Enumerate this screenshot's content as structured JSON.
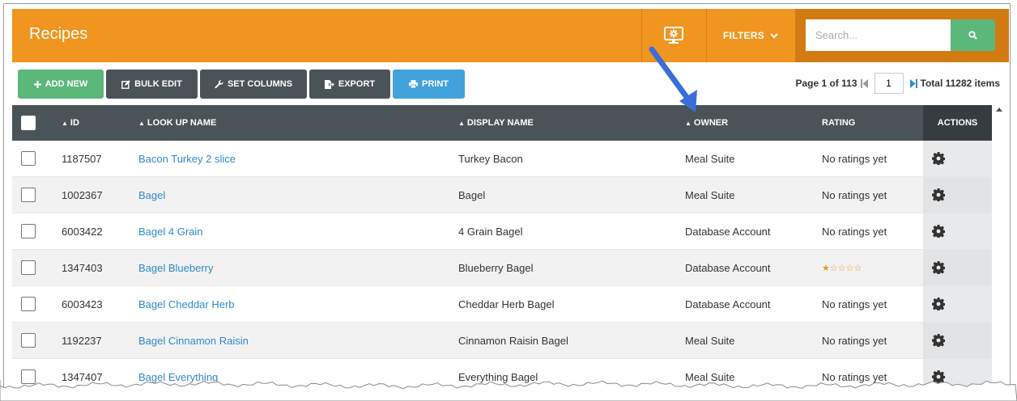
{
  "header": {
    "title": "Recipes",
    "filters_label": "FILTERS",
    "search_placeholder": "Search..."
  },
  "toolbar": {
    "add_new": "ADD NEW",
    "bulk_edit": "BULK EDIT",
    "set_columns": "SET COLUMNS",
    "export": "EXPORT",
    "print": "PRINT"
  },
  "pager": {
    "page_text": "Page 1 of 113",
    "current_page": "1",
    "total_text": "Total 11282 items"
  },
  "columns": {
    "id": "ID",
    "lookup_name": "LOOK UP NAME",
    "display_name": "DISPLAY NAME",
    "owner": "OWNER",
    "rating": "RATING",
    "actions": "ACTIONS"
  },
  "rows": [
    {
      "id": "1187507",
      "lookup": "Bacon Turkey 2 slice",
      "display": "Turkey Bacon",
      "owner": "Meal Suite",
      "rating": "No ratings yet",
      "stars": 0
    },
    {
      "id": "1002367",
      "lookup": "Bagel",
      "display": "Bagel",
      "owner": "Meal Suite",
      "rating": "No ratings yet",
      "stars": 0
    },
    {
      "id": "6003422",
      "lookup": "Bagel 4 Grain",
      "display": "4 Grain Bagel",
      "owner": "Database Account",
      "rating": "No ratings yet",
      "stars": 0
    },
    {
      "id": "1347403",
      "lookup": "Bagel Blueberry",
      "display": "Blueberry Bagel",
      "owner": "Database Account",
      "rating": "",
      "stars": 1
    },
    {
      "id": "6003423",
      "lookup": "Bagel Cheddar Herb",
      "display": "Cheddar Herb Bagel",
      "owner": "Database Account",
      "rating": "No ratings yet",
      "stars": 0
    },
    {
      "id": "1192237",
      "lookup": "Bagel Cinnamon Raisin",
      "display": "Cinnamon Raisin Bagel",
      "owner": "Meal Suite",
      "rating": "No ratings yet",
      "stars": 0
    },
    {
      "id": "1347407",
      "lookup": "Bagel Everything",
      "display": "Everything Bagel",
      "owner": "Meal Suite",
      "rating": "No ratings yet",
      "stars": 0
    }
  ],
  "colors": {
    "header_orange": "#f0951f",
    "search_bg": "#d27b12",
    "green": "#5cb87a",
    "dark": "#4a5358",
    "blue": "#42a2dc",
    "link": "#2f8ac8",
    "annotation_arrow": "#3a6fd8"
  },
  "icons": {
    "monitor": "monitor-gear-icon",
    "search": "search-icon",
    "row_action": "gear-icon"
  }
}
